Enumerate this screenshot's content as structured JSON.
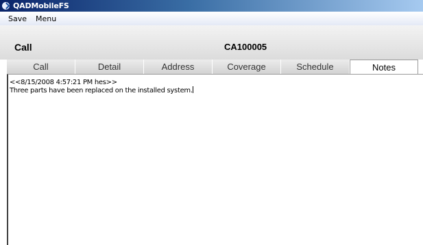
{
  "window": {
    "title": "QADMobileFS",
    "icon": "app-logo-icon"
  },
  "menu": {
    "items": [
      "Save",
      "Menu"
    ]
  },
  "header": {
    "title": "Call",
    "record_id": "CA100005"
  },
  "tabs": [
    {
      "label": "Call"
    },
    {
      "label": "Detail"
    },
    {
      "label": "Address"
    },
    {
      "label": "Coverage"
    },
    {
      "label": "Schedule"
    },
    {
      "label": "Notes",
      "active": true
    }
  ],
  "notes": {
    "lines": [
      "<<8/15/2008 4:57:21 PM hes>>",
      "Three parts have been replaced on the installed system."
    ]
  }
}
